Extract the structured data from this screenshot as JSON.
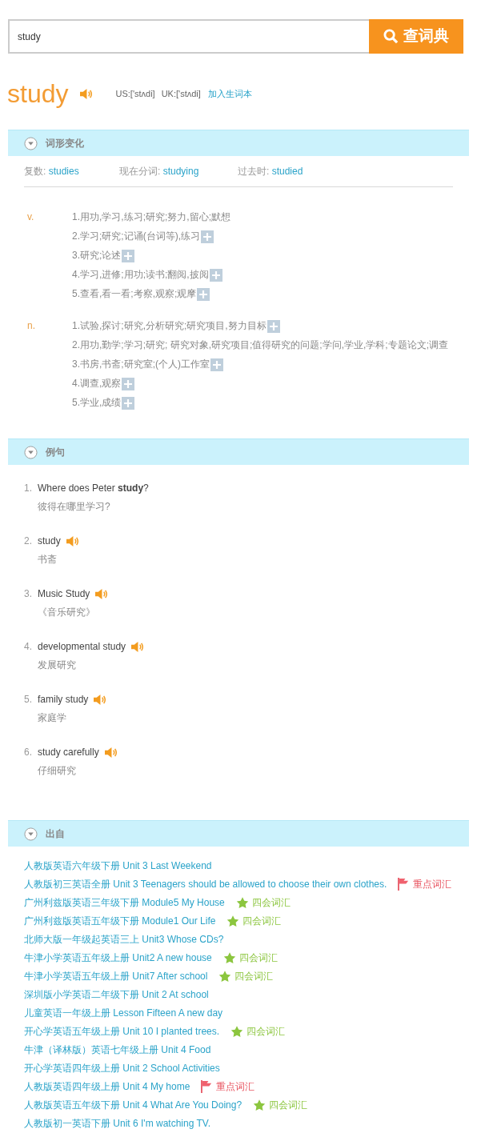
{
  "search": {
    "value": "study",
    "button": "查词典"
  },
  "word": {
    "headword": "study",
    "phonetics": [
      {
        "region": "US:",
        "ipa": "['stʌdi]"
      },
      {
        "region": "UK:",
        "ipa": "['stʌdi]"
      }
    ],
    "add_link": "加入生词本"
  },
  "forms_section": {
    "title": "词形变化",
    "forms": [
      {
        "label": "复数:",
        "value": "studies"
      },
      {
        "label": "现在分词:",
        "value": "studying"
      },
      {
        "label": "过去时:",
        "value": "studied"
      }
    ]
  },
  "definitions": [
    {
      "pos": "v.",
      "senses": [
        {
          "text": "1.用功,学习,练习;研究;努力,留心;默想",
          "expandable": false
        },
        {
          "text": "2.学习;研究;记诵(台词等),练习",
          "expandable": true
        },
        {
          "text": "3.研究;论述",
          "expandable": true
        },
        {
          "text": "4.学习,进修;用功;读书;翻阅,披阅",
          "expandable": true
        },
        {
          "text": "5.查看,看一看;考察,观察;观摩",
          "expandable": true
        }
      ]
    },
    {
      "pos": "n.",
      "senses": [
        {
          "text": "1.试验,探讨;研究,分析研究;研究项目,努力目标",
          "expandable": true
        },
        {
          "text": "2.用功,勤学;学习;研究; 研究对象,研究项目;值得研究的问题;学问,学业,学科;专题论文;调查",
          "expandable": false
        },
        {
          "text": "3.书房,书斋;研究室;(个人)工作室",
          "expandable": true
        },
        {
          "text": "4.调查,观察",
          "expandable": true
        },
        {
          "text": "5.学业,成绩",
          "expandable": true
        }
      ]
    }
  ],
  "examples_section": {
    "title": "例句",
    "examples": [
      {
        "number": "1.",
        "sentence": "Where does Peter **study**?",
        "translation": "彼得在哪里学习?",
        "audio": false
      },
      {
        "number": "2.",
        "sentence": "study",
        "translation": "书斋",
        "audio": true
      },
      {
        "number": "3.",
        "sentence": "Music Study",
        "translation": "《音乐研究》",
        "audio": true
      },
      {
        "number": "4.",
        "sentence": "developmental study",
        "translation": "发展研究",
        "audio": true
      },
      {
        "number": "5.",
        "sentence": "family study",
        "translation": "家庭学",
        "audio": true
      },
      {
        "number": "6.",
        "sentence": "study carefully",
        "translation": "仔细研究",
        "audio": true
      }
    ]
  },
  "sources_section": {
    "title": "出自",
    "sources": [
      {
        "book": "人教版英语六年级下册",
        "unit": "Unit 3 Last Weekend"
      },
      {
        "book": "人教版初三英语全册",
        "unit": "Unit 3 Teenagers should be allowed to choose their own clothes.",
        "tag": {
          "kind": "flag",
          "label": "重点词汇"
        }
      },
      {
        "book": "广州利兹版英语三年级下册",
        "unit": "Module5 My House",
        "tag": {
          "kind": "star",
          "label": "四会词汇"
        }
      },
      {
        "book": "广州利兹版英语五年级下册",
        "unit": "Module1 Our Life",
        "tag": {
          "kind": "star",
          "label": "四会词汇"
        }
      },
      {
        "book": "北师大版一年级起英语三上",
        "unit": "Unit3 Whose CDs?"
      },
      {
        "book": "牛津小学英语五年级上册",
        "unit": "Unit2 A new house",
        "tag": {
          "kind": "star",
          "label": "四会词汇"
        }
      },
      {
        "book": "牛津小学英语五年级上册",
        "unit": "Unit7 After school",
        "tag": {
          "kind": "star",
          "label": "四会词汇"
        }
      },
      {
        "book": "深圳版小学英语二年级下册",
        "unit": "Unit 2 At school"
      },
      {
        "book": "儿童英语一年级上册",
        "unit": "Lesson Fifteen A new day"
      },
      {
        "book": "开心学英语五年级上册",
        "unit": "Unit 10 I planted trees.",
        "tag": {
          "kind": "star",
          "label": "四会词汇"
        }
      },
      {
        "book": "牛津（译林版）英语七年级上册",
        "unit": "Unit 4 Food"
      },
      {
        "book": "开心学英语四年级上册",
        "unit": "Unit 2 School Activities"
      },
      {
        "book": "人教版英语四年级上册",
        "unit": "Unit 4 My home",
        "tag": {
          "kind": "flag",
          "label": "重点词汇"
        }
      },
      {
        "book": "人教版英语五年级下册",
        "unit": "Unit 4 What Are You Doing?",
        "tag": {
          "kind": "star",
          "label": "四会词汇"
        }
      },
      {
        "book": "人教版初一英语下册",
        "unit": "Unit 6 I'm watching TV."
      }
    ]
  }
}
